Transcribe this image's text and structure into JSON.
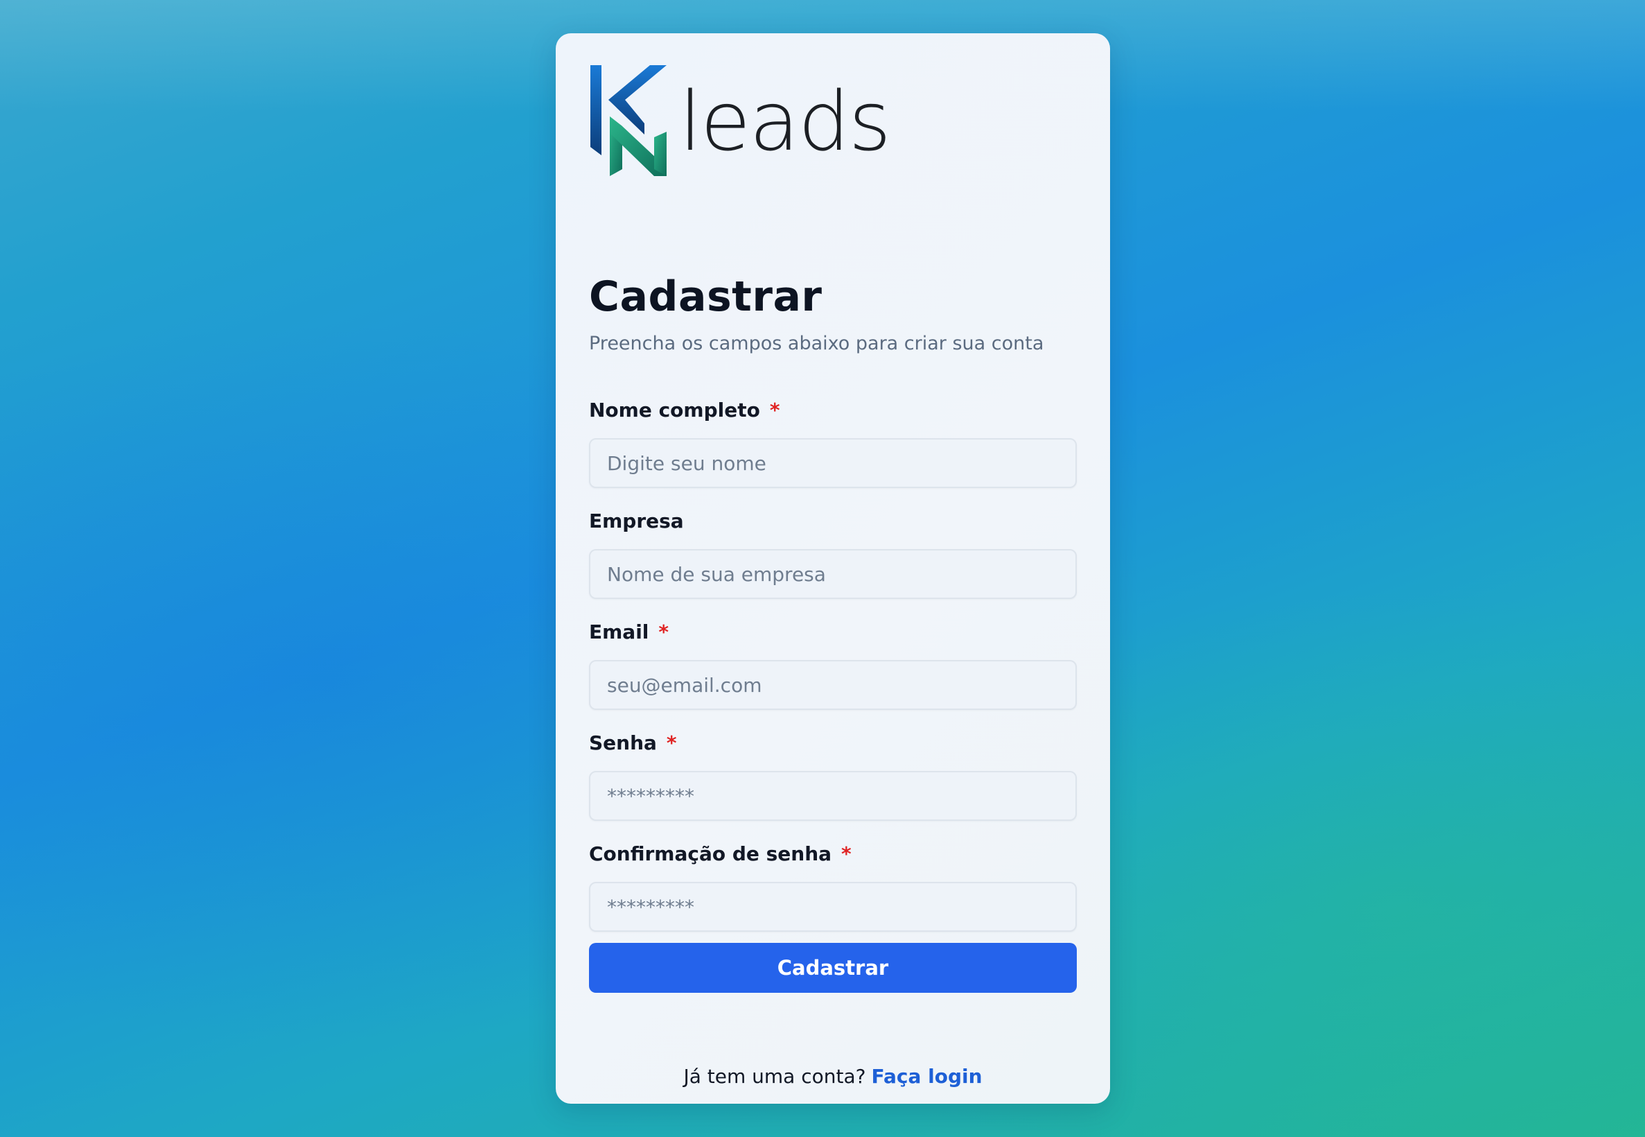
{
  "brand": {
    "name": "leads",
    "colors": {
      "primary": "#2563eb",
      "logo_blue": "#1470c8",
      "logo_green": "#1fa37a",
      "required": "#e02424",
      "link": "#1d5fd6"
    }
  },
  "header": {
    "title": "Cadastrar",
    "subtitle": "Preencha os campos abaixo para criar sua conta"
  },
  "form": {
    "required_mark": "*",
    "fields": {
      "name": {
        "label": "Nome completo",
        "placeholder": "Digite seu nome",
        "value": ""
      },
      "company": {
        "label": "Empresa",
        "placeholder": "Nome de sua empresa",
        "value": ""
      },
      "email": {
        "label": "Email",
        "placeholder": "seu@email.com",
        "value": ""
      },
      "password": {
        "label": "Senha",
        "placeholder": "*********",
        "value": ""
      },
      "password_confirm": {
        "label": "Confirmação de senha",
        "placeholder": "*********",
        "value": ""
      }
    },
    "submit_label": "Cadastrar"
  },
  "footer": {
    "prompt": "Já tem uma conta?",
    "login_link": "Faça login"
  }
}
